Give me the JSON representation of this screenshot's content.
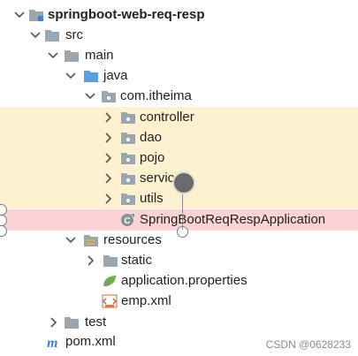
{
  "tree": {
    "project": "springboot-web-req-resp",
    "src": "src",
    "main": "main",
    "java": "java",
    "package": "com.itheima",
    "controller": "controller",
    "dao": "dao",
    "pojo": "pojo",
    "service": "service",
    "utils": "utils",
    "app_class": "SpringBootReqRespApplication",
    "resources": "resources",
    "static": "static",
    "app_properties": "application.properties",
    "emp_xml": "emp.xml",
    "test": "test",
    "pom": "pom.xml"
  },
  "watermark": "CSDN @0628233",
  "colors": {
    "folder": "#9aa7b0",
    "folder_blue": "#5aa0e0",
    "highlight_yellow": "#fdf1d0",
    "highlight_red": "#fcd4d6"
  }
}
